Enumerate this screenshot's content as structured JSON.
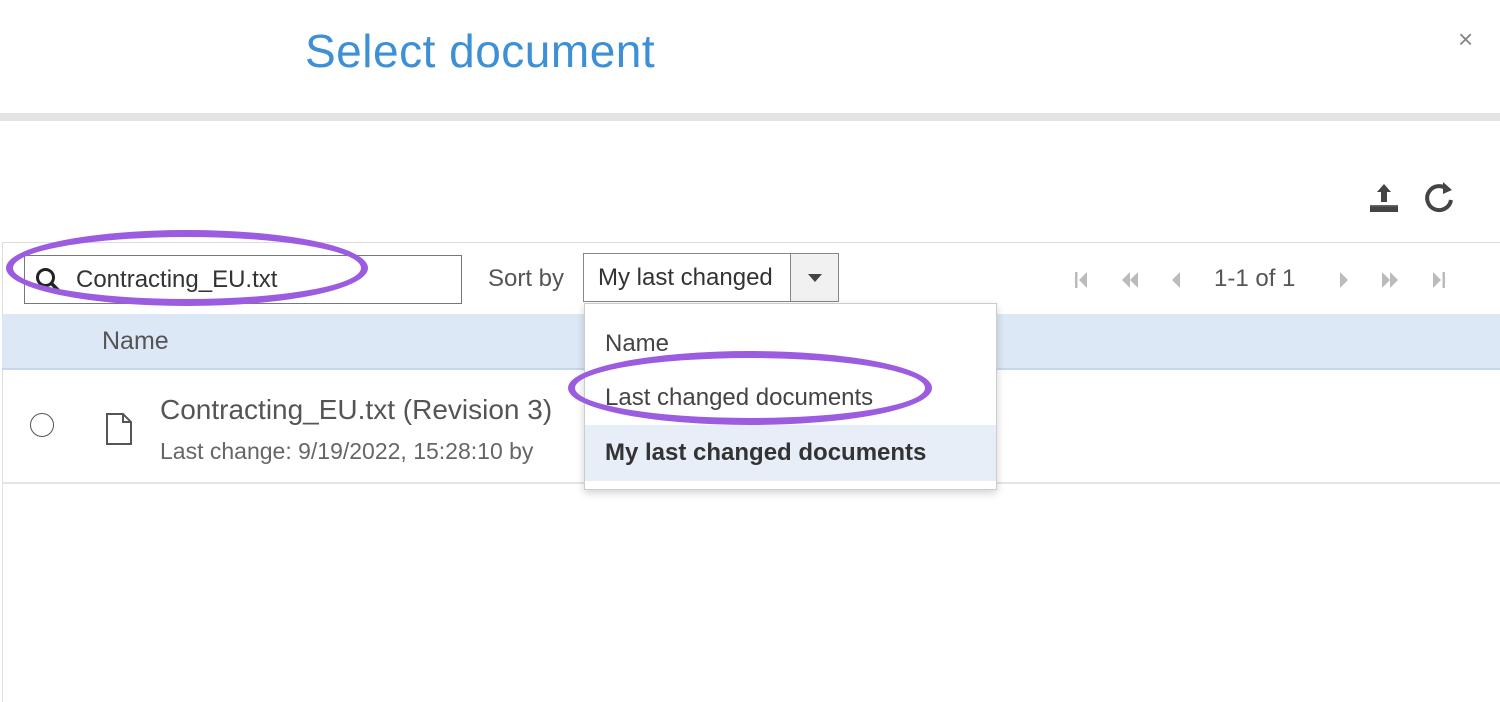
{
  "dialog": {
    "title": "Select document",
    "close_label": "×"
  },
  "toolbar": {
    "upload_icon": "upload-icon",
    "refresh_icon": "refresh-icon"
  },
  "search": {
    "value": "Contracting_EU.txt"
  },
  "sort": {
    "label": "Sort by",
    "selected": "My last changed",
    "options": [
      "Name",
      "Last changed documents",
      "My last changed documents"
    ],
    "highlighted_option": "My last changed documents"
  },
  "pager": {
    "text": "1-1 of 1"
  },
  "table": {
    "columns": [
      "Name"
    ],
    "rows": [
      {
        "title": "Contracting_EU.txt (Revision 3)",
        "meta": "Last change: 9/19/2022, 15:28:10 by"
      }
    ]
  },
  "colors": {
    "title": "#3d8fd6",
    "header_bg": "#dce8f6",
    "highlight": "#e7eef8",
    "annotation": "#9b5ce0"
  }
}
